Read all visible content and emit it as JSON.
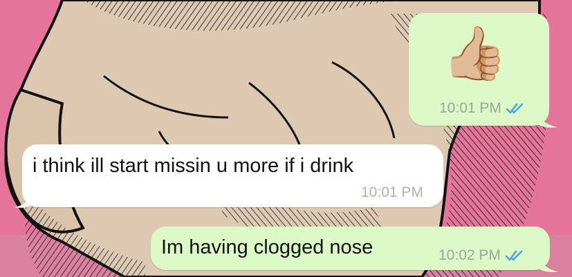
{
  "messages": [
    {
      "direction": "outgoing",
      "content": "👍🏼",
      "time": "10:01 PM",
      "status": "read-check-icon"
    },
    {
      "direction": "incoming",
      "text": "i think ill start missin u more if i drink",
      "time": "10:01 PM"
    },
    {
      "direction": "outgoing",
      "text": "Im having clogged nose",
      "time": "10:02 PM",
      "status": "read-check-icon"
    }
  ],
  "colors": {
    "wallpaper_pink": "#e5749b",
    "outgoing_bubble": "#dcf8c6",
    "incoming_bubble": "#ffffff",
    "read_checks": "#4fa3e0"
  }
}
